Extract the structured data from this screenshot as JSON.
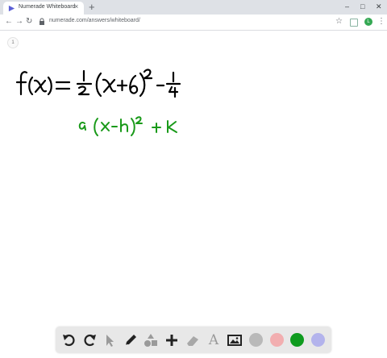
{
  "browser": {
    "tab_title": "Numerade Whiteboard",
    "new_tab_glyph": "+",
    "url": "numerade.com/answers/whiteboard/",
    "profile_initial": "L",
    "icons": [
      "favicon-icon",
      "close-icon",
      "back-icon",
      "forward-icon",
      "reload-icon",
      "lock-icon",
      "star-icon",
      "extension-icon",
      "menu-icon",
      "minimize-icon",
      "maximize-icon"
    ]
  },
  "whiteboard": {
    "page_indicator": "1",
    "equation": "f(x) = 1/2 (x+6)^2 - 1/4",
    "vertex_form": "a(x-h)^2 + k",
    "ink_colors": {
      "black": "#000000",
      "green": "#1a9a1a"
    }
  },
  "toolbar": {
    "tools": [
      "undo-icon",
      "redo-icon",
      "select-icon",
      "pen-icon",
      "shapes-icon",
      "add-icon",
      "eraser-icon",
      "text-icon",
      "image-icon"
    ],
    "text_tool_glyph": "A",
    "colors": [
      "#b9b9b9",
      "#f2aeb0",
      "#0f9b1f",
      "#b3b3ec"
    ]
  }
}
